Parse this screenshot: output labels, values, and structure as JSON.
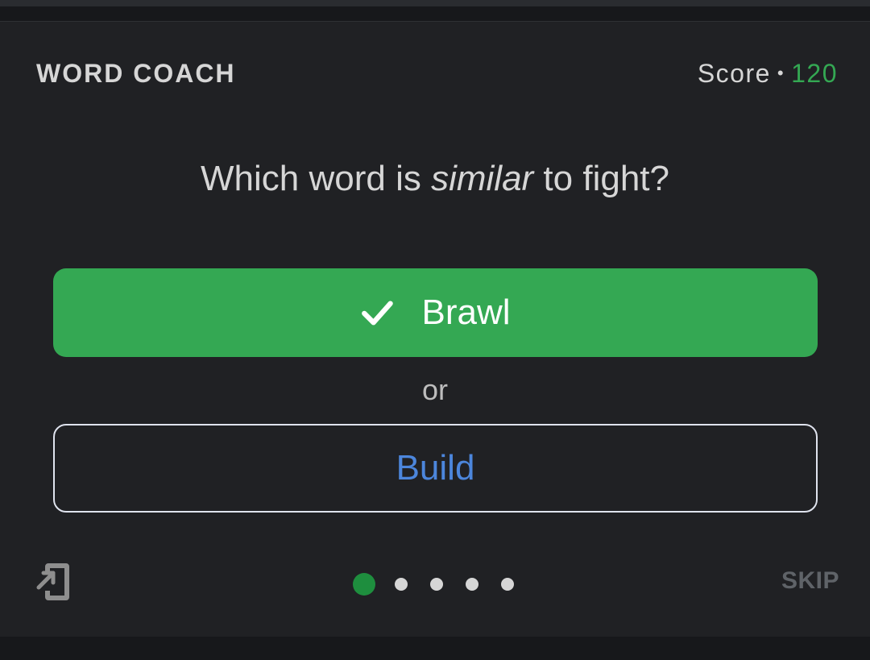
{
  "header": {
    "title": "WORD COACH",
    "score_label": "Score",
    "score_separator": "•",
    "score_value": "120"
  },
  "question": {
    "prefix": "Which word is ",
    "emphasis": "similar",
    "suffix": " to fight?"
  },
  "choices": {
    "option_a": {
      "label": "Brawl",
      "state": "correct",
      "icon": "check-icon"
    },
    "separator": "or",
    "option_b": {
      "label": "Build"
    }
  },
  "footer": {
    "share_icon": "share-to-device-icon",
    "progress": {
      "total": 5,
      "current": 1
    },
    "skip_label": "SKIP"
  },
  "colors": {
    "correct_green": "#34a853",
    "score_green": "#34a853",
    "active_dot": "#1e8e3e",
    "link_blue": "#4c86dc",
    "card_bg": "#202124"
  }
}
